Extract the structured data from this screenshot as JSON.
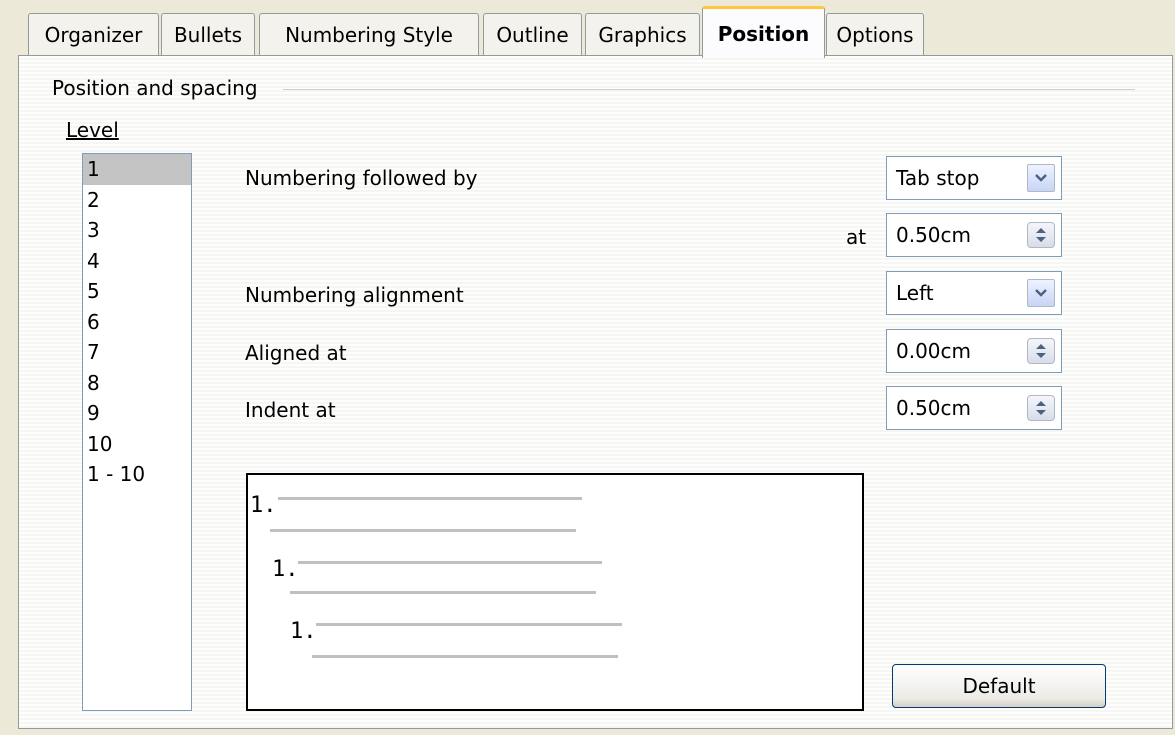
{
  "tabs": [
    {
      "label": "Organizer",
      "active": false
    },
    {
      "label": "Bullets",
      "active": false
    },
    {
      "label": "Numbering Style",
      "active": false
    },
    {
      "label": "Outline",
      "active": false
    },
    {
      "label": "Graphics",
      "active": false
    },
    {
      "label": "Position",
      "active": true
    },
    {
      "label": "Options",
      "active": false
    }
  ],
  "section_title": "Position and spacing",
  "level": {
    "label": "Level",
    "items": [
      "1",
      "2",
      "3",
      "4",
      "5",
      "6",
      "7",
      "8",
      "9",
      "10",
      "1 - 10"
    ],
    "selected": "1"
  },
  "numbering_followed_by": {
    "label": "Numbering followed by",
    "value": "Tab stop"
  },
  "at": {
    "label": "at",
    "value": "0.50cm"
  },
  "numbering_alignment": {
    "label": "Numbering alignment",
    "value": "Left"
  },
  "aligned_at": {
    "label": "Aligned at",
    "value": "0.00cm"
  },
  "indent_at": {
    "label": "Indent at",
    "value": "0.50cm"
  },
  "preview": {
    "numbers": [
      "1.",
      "1.",
      "1."
    ]
  },
  "default_button": "Default",
  "icons": {
    "dropdown": "chevron-down-icon",
    "spin": "spin-up-down-icon"
  },
  "colors": {
    "active_tab_accent": "#ffc83c",
    "field_border": "#7f9db9",
    "selection": "#c3c3c3"
  }
}
